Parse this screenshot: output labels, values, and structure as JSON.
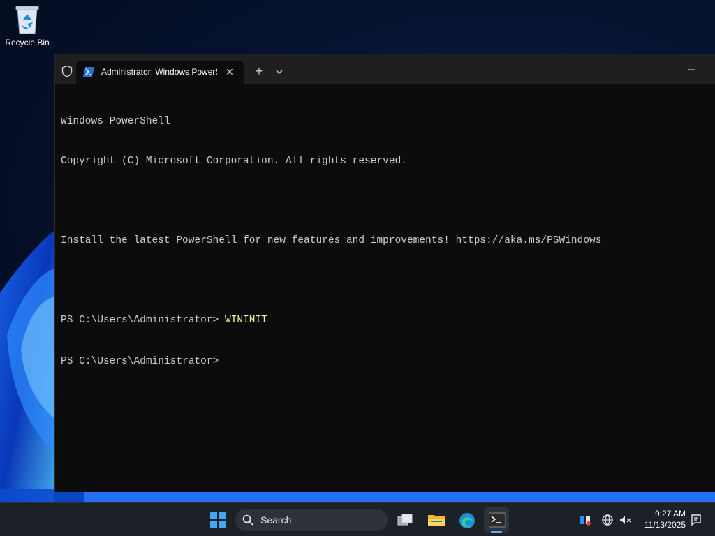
{
  "desktop": {
    "icons": [
      {
        "label": "Recycle Bin",
        "icon": "recycle-bin-icon"
      }
    ]
  },
  "terminal": {
    "tab_title": "Administrator: Windows PowerShell",
    "lines": [
      {
        "text": "Windows PowerShell"
      },
      {
        "text": "Copyright (C) Microsoft Corporation. All rights reserved."
      },
      {
        "text": ""
      },
      {
        "text": "Install the latest PowerShell for new features and improvements! https://aka.ms/PSWindows"
      },
      {
        "text": ""
      }
    ],
    "prompt1": "PS C:\\Users\\Administrator> ",
    "command1": "WININIT",
    "prompt2": "PS C:\\Users\\Administrator> ",
    "colors": {
      "background": "#0c0c0c",
      "text": "#cccccc",
      "command": "#f9f1a5"
    }
  },
  "taskbar": {
    "search_label": "Search",
    "apps": [
      "start-icon",
      "task-view-icon",
      "file-explorer-icon",
      "edge-icon",
      "terminal-icon"
    ],
    "time": "9:27 AM",
    "date": "11/13/2025",
    "accent": "#5ab0ff"
  }
}
